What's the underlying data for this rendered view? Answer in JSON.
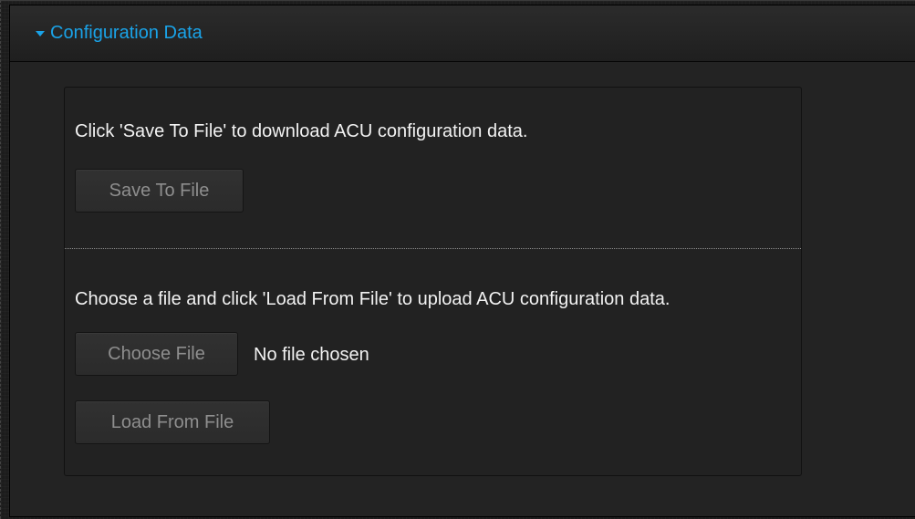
{
  "panel": {
    "title": "Configuration Data"
  },
  "save_section": {
    "description": "Click 'Save To File' to download ACU configuration data.",
    "save_button": "Save To File"
  },
  "load_section": {
    "description": "Choose a file and click 'Load From File' to upload ACU configuration data.",
    "choose_file_button": "Choose File",
    "file_status": "No file chosen",
    "load_button": "Load From File"
  },
  "icons": {
    "collapse": "caret-down-icon"
  },
  "colors": {
    "accent": "#1aa3e8",
    "background": "#1c1c1c",
    "panel": "#232323",
    "text": "#f2f2f2",
    "disabled_text": "#8e8e8e"
  }
}
